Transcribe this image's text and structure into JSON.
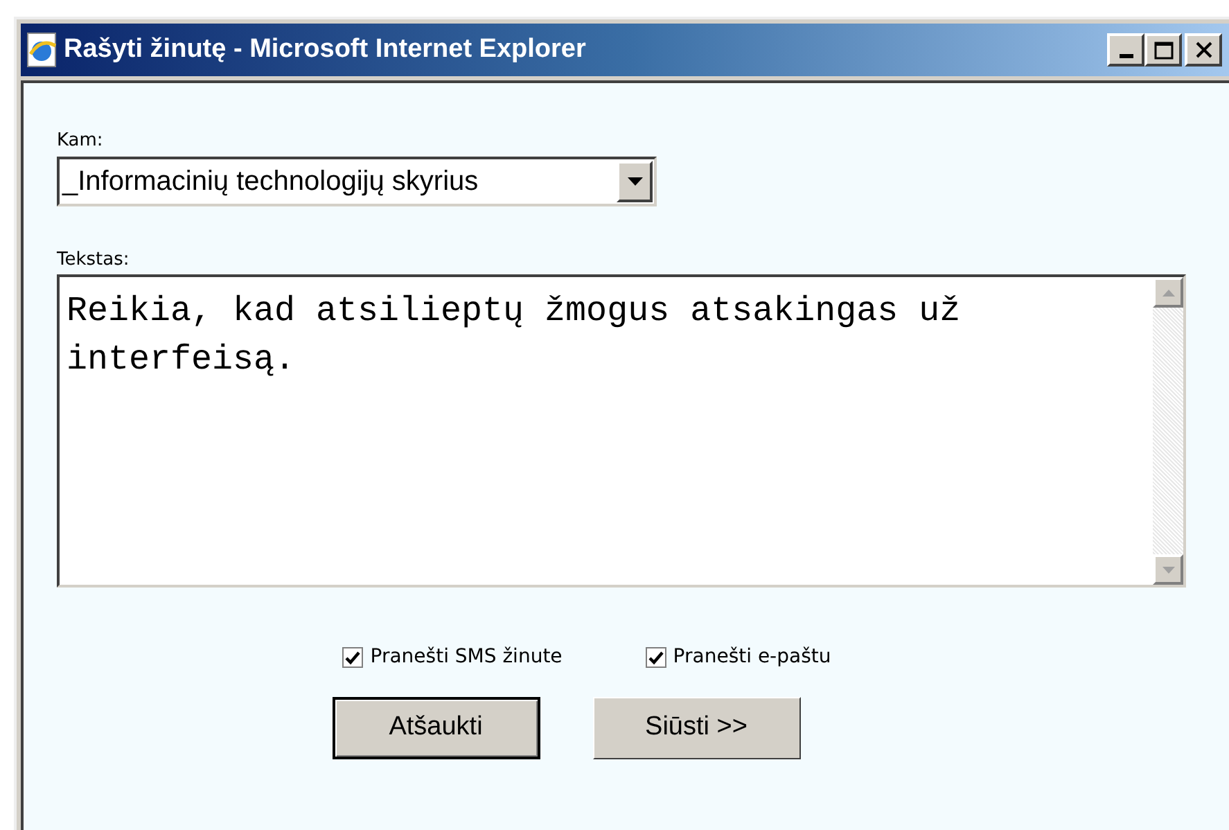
{
  "window": {
    "title": "Rašyti žinutę - Microsoft Internet Explorer"
  },
  "recipient": {
    "label": "Kam:",
    "value": "_Informacinių technologijų skyrius"
  },
  "message": {
    "label": "Tekstas:",
    "value": "Reikia, kad atsilieptų žmogus atsakingas už interfeisą."
  },
  "options": [
    {
      "label": "Pranešti SMS žinute",
      "checked": true
    },
    {
      "label": "Pranešti e-paštu",
      "checked": true
    }
  ],
  "buttons": [
    {
      "label": "Atšaukti",
      "default": true
    },
    {
      "label": "Siūsti >>",
      "default": false
    }
  ]
}
